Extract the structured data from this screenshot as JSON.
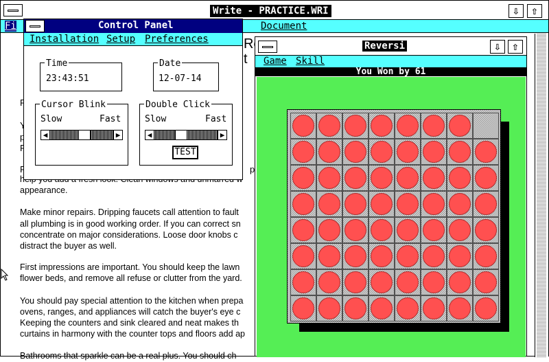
{
  "write": {
    "title": "Write - PRACTICE.WRI",
    "menu": [
      "Fi",
      "Document"
    ],
    "partial_text": [
      "Re",
      "t",
      "F",
      "Y",
      "p",
      "R",
      "F",
      "p"
    ],
    "paragraphs": [
      [
        "help you add a fresh look.  Clean windows and unmarred w",
        "appearance."
      ],
      [
        "Make minor repairs.  Dripping faucets call attention to fault",
        "all plumbing is in good working order.  If you can correct sn",
        "concentrate on major considerations.  Loose door knobs c",
        "distract the buyer as well."
      ],
      [
        "First impressions are important.  You should keep the lawn",
        "flower beds, and remove all refuse or clutter from the yard."
      ],
      [
        "You should pay special attention to the kitchen when prepa",
        "ovens, ranges, and appliances will catch the buyer's eye c",
        "Keeping the counters and sink cleared and neat makes th",
        "curtains in harmony with the counter tops and floors add ap"
      ],
      [
        "Bathrooms that sparkle can be a real plus.  You should ch"
      ]
    ]
  },
  "control_panel": {
    "title": "Control Panel",
    "menu": [
      "Installation",
      "Setup",
      "Preferences"
    ],
    "time_label": "Time",
    "time_value": "23:43:51",
    "date_label": "Date",
    "date_value": "12-07-14",
    "cursor_blink": {
      "label": "Cursor Blink",
      "slow": "Slow",
      "fast": "Fast",
      "level": 0.55
    },
    "double_click": {
      "label": "Double Click",
      "slow": "Slow",
      "fast": "Fast",
      "level": 0.4
    },
    "test_button": "TEST"
  },
  "reversi": {
    "title": "Reversi",
    "menu": [
      "Game",
      "Skill"
    ],
    "status": "You Won by 61",
    "board": [
      [
        1,
        1,
        1,
        1,
        1,
        1,
        1,
        0
      ],
      [
        1,
        1,
        1,
        1,
        1,
        1,
        1,
        1
      ],
      [
        1,
        1,
        1,
        1,
        1,
        1,
        1,
        1
      ],
      [
        1,
        1,
        1,
        1,
        1,
        1,
        1,
        1
      ],
      [
        1,
        1,
        1,
        1,
        1,
        1,
        1,
        1
      ],
      [
        1,
        1,
        1,
        1,
        1,
        1,
        1,
        1
      ],
      [
        1,
        1,
        1,
        1,
        1,
        1,
        1,
        1
      ],
      [
        1,
        1,
        1,
        1,
        1,
        1,
        1,
        1
      ]
    ],
    "colors": {
      "felt": "#55ee55",
      "piece": "#ff5050",
      "titlebar": "#000080"
    }
  },
  "icons": [
    "system-menu-icon",
    "minimize-arrow-icon",
    "maximize-arrow-icon",
    "left-arrow-icon",
    "right-arrow-icon",
    "mouse-pointer-icon"
  ]
}
